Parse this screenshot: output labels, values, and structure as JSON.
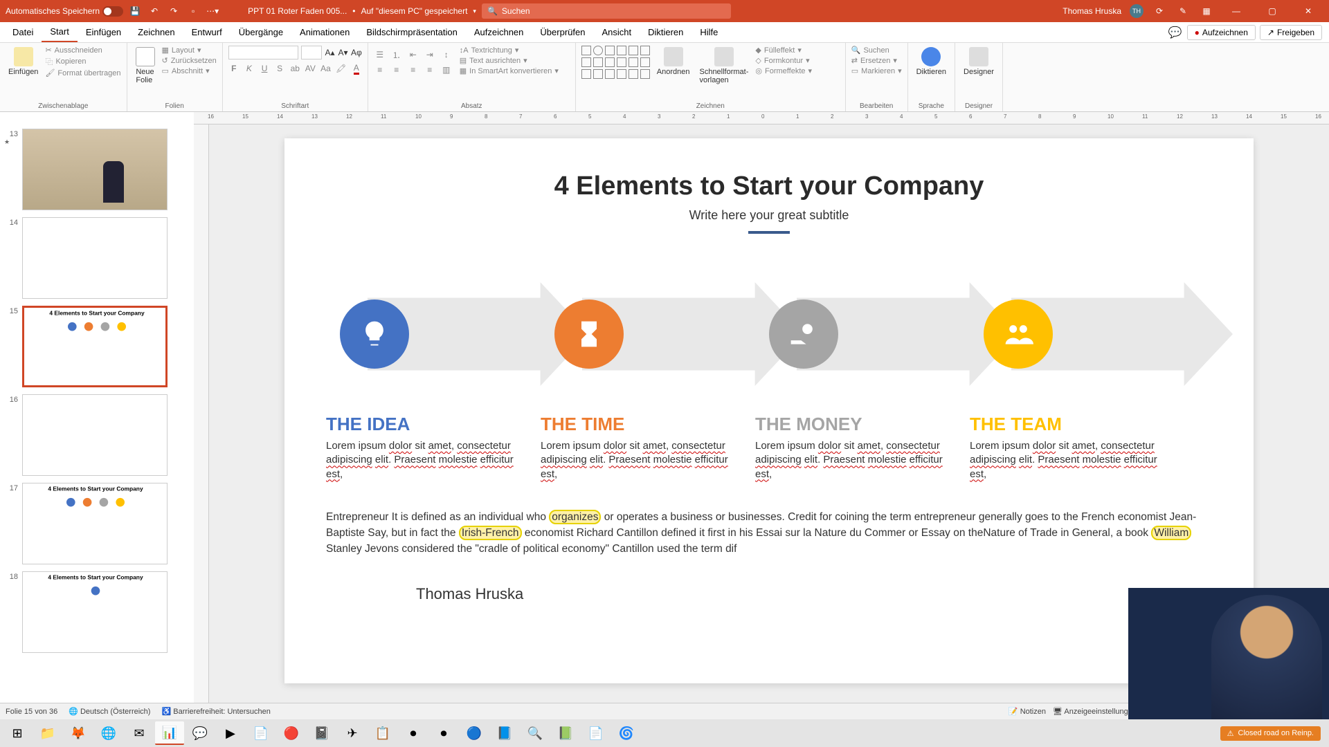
{
  "titlebar": {
    "autosave_label": "Automatisches Speichern",
    "doc_name": "PPT 01 Roter Faden 005...",
    "saved_location": "Auf \"diesem PC\" gespeichert",
    "search_placeholder": "Suchen",
    "user_name": "Thomas Hruska",
    "user_initials": "TH"
  },
  "tabs": [
    "Datei",
    "Start",
    "Einfügen",
    "Zeichnen",
    "Entwurf",
    "Übergänge",
    "Animationen",
    "Bildschirmpräsentation",
    "Aufzeichnen",
    "Überprüfen",
    "Ansicht",
    "Diktieren",
    "Hilfe"
  ],
  "tabs_active": 1,
  "tab_right": {
    "record": "Aufzeichnen",
    "share": "Freigeben"
  },
  "ribbon": {
    "clipboard": {
      "label": "Zwischenablage",
      "paste": "Einfügen",
      "cut": "Ausschneiden",
      "copy": "Kopieren",
      "format": "Format übertragen"
    },
    "slides": {
      "label": "Folien",
      "new": "Neue\nFolie",
      "layout": "Layout",
      "reset": "Zurücksetzen",
      "section": "Abschnitt"
    },
    "font": {
      "label": "Schriftart"
    },
    "paragraph": {
      "label": "Absatz",
      "textdir": "Textrichtung",
      "align": "Text ausrichten",
      "smartart": "In SmartArt konvertieren"
    },
    "drawing": {
      "label": "Zeichnen",
      "arrange": "Anordnen",
      "quickfmt": "Schnellformat-\nvorlagen",
      "fill": "Fülleffekt",
      "outline": "Formkontur",
      "effects": "Formeffekte"
    },
    "editing": {
      "label": "Bearbeiten",
      "find": "Suchen",
      "replace": "Ersetzen",
      "select": "Markieren"
    },
    "voice": {
      "label": "Sprache",
      "dictate": "Diktieren"
    },
    "designer": {
      "label": "Designer",
      "btn": "Designer"
    }
  },
  "thumbs": [
    {
      "num": "13",
      "star": "★",
      "kind": "photo"
    },
    {
      "num": "14",
      "star": "",
      "kind": "blank"
    },
    {
      "num": "15",
      "star": "",
      "kind": "elem4",
      "selected": true
    },
    {
      "num": "16",
      "star": "",
      "kind": "blank"
    },
    {
      "num": "17",
      "star": "",
      "kind": "elem4b"
    },
    {
      "num": "18",
      "star": "",
      "kind": "elem4c"
    }
  ],
  "slide": {
    "title": "4 Elements to Start your Company",
    "subtitle": "Write here your great subtitle",
    "elements": [
      {
        "title": "THE IDEA",
        "cls": "blue"
      },
      {
        "title": "THE TIME",
        "cls": "orange"
      },
      {
        "title": "THE MONEY",
        "cls": "grey"
      },
      {
        "title": "THE TEAM",
        "cls": "yellow"
      }
    ],
    "element_body": "Lorem ipsum dolor sit amet, consectetur adipiscing elit. Praesent molestie efficitur est,",
    "paragraph_a": "Entrepreneur  It is defined as an individual who ",
    "paragraph_hl1": "organizes",
    "paragraph_b": " or operates a business or businesses. Credit for coining the term entrepreneur generally goes to the French economist Jean-Baptiste Say, but in fact the ",
    "paragraph_hl2": "Irish-French",
    "paragraph_c": " economist Richard Cantillon defined it first in his Essai sur la Nature du Commer or Essay on theNature of Trade in General, a book ",
    "paragraph_hl3": "William",
    "paragraph_d": " Stanley Jevons considered the \"cradle of political economy\" Cantillon used the term dif",
    "author": "Thomas Hruska"
  },
  "statusbar": {
    "slide_count": "Folie 15 von 36",
    "language": "Deutsch (Österreich)",
    "accessibility": "Barrierefreiheit: Untersuchen",
    "notes": "Notizen",
    "display_settings": "Anzeigeeinstellungen"
  },
  "taskbar": {
    "notification": "Closed road on Reinp."
  },
  "ruler_h_numbers": [
    "16",
    "15",
    "14",
    "13",
    "12",
    "11",
    "10",
    "9",
    "8",
    "7",
    "6",
    "5",
    "4",
    "3",
    "2",
    "1",
    "0",
    "1",
    "2",
    "3",
    "4",
    "5",
    "6",
    "7",
    "8",
    "9",
    "10",
    "11",
    "12",
    "13",
    "14",
    "15",
    "16"
  ]
}
